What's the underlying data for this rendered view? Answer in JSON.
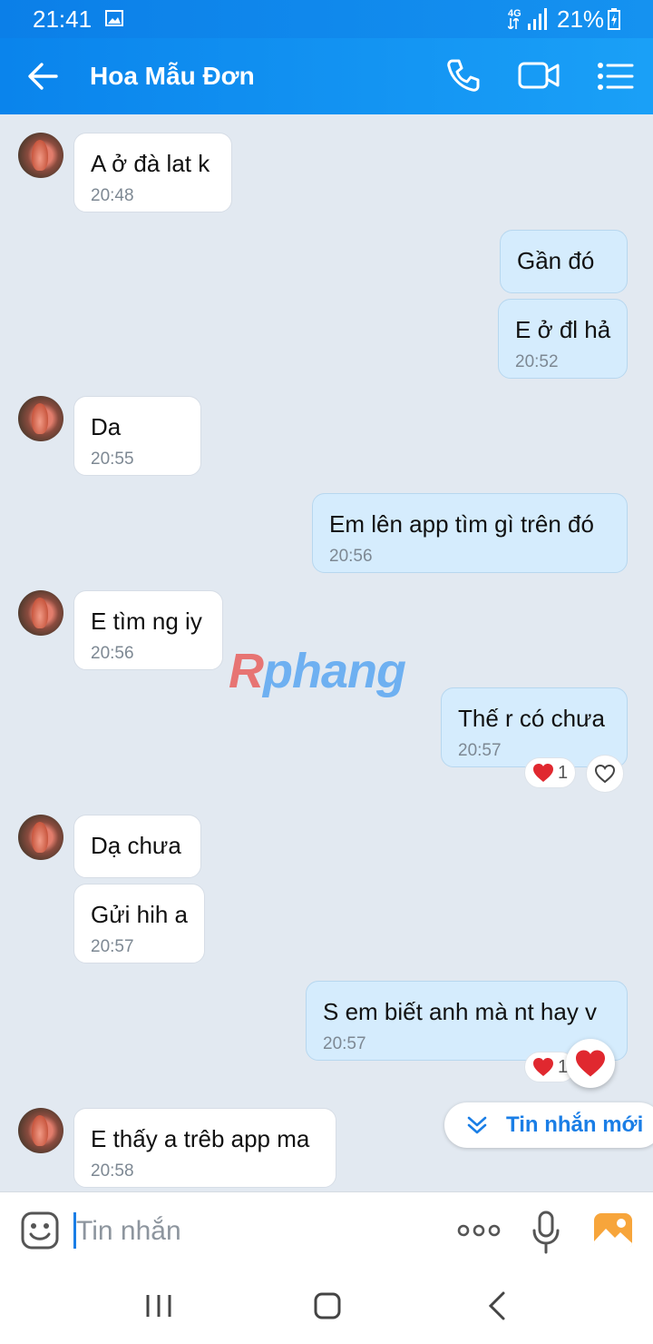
{
  "status_bar": {
    "time": "21:41",
    "network": "4G",
    "battery": "21%"
  },
  "header": {
    "title": "Hoa Mẫu Đơn"
  },
  "watermark": {
    "part1": "R",
    "part2": "phang"
  },
  "messages": [
    {
      "dir": "in",
      "text": "A ở đà lat k",
      "time": "20:48"
    },
    {
      "dir": "out",
      "text": "Gần đó",
      "time": ""
    },
    {
      "dir": "out",
      "text": "E ở đl hả",
      "time": "20:52"
    },
    {
      "dir": "in",
      "text": "Da",
      "time": "20:55"
    },
    {
      "dir": "out",
      "text": "Em lên app tìm gì trên đó",
      "time": "20:56"
    },
    {
      "dir": "in",
      "text": "E tìm ng iy",
      "time": "20:56"
    },
    {
      "dir": "out",
      "text": "Thế r có chưa",
      "time": "20:57",
      "reaction_count": "1"
    },
    {
      "dir": "in",
      "text": "Dạ chưa",
      "time": ""
    },
    {
      "dir": "in",
      "text": "Gửi hih a",
      "time": "20:57"
    },
    {
      "dir": "out",
      "text": "S em biết anh mà nt hay v",
      "time": "20:57",
      "reaction_count": "1"
    },
    {
      "dir": "in",
      "text": "E thấy a trêb app ma",
      "time": "20:58"
    }
  ],
  "new_messages_button": {
    "label": "Tin nhắn mới"
  },
  "composer": {
    "placeholder": "Tin nhắn"
  },
  "colors": {
    "header": "#0a84ec",
    "accent": "#1a7ee6",
    "outgoing_bubble": "#d5ecfd",
    "background": "#e2e9f1"
  }
}
